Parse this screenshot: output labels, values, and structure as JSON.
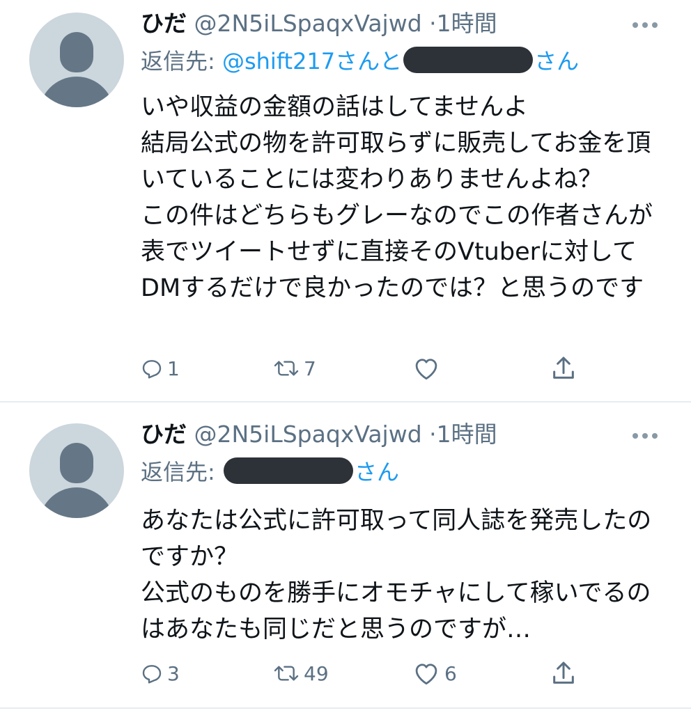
{
  "tweets": [
    {
      "author_name": "ひだ",
      "handle": "@2N5iLSpaqxVajwd",
      "separator": "·",
      "time": "1時間",
      "reply_label": "返信先:",
      "reply_mention": "@shift217さんと",
      "reply_suffix": "さん",
      "text": "いや収益の金額の話はしてませんよ\n結局公式の物を許可取らずに販売してお金を頂いていることには変わりありませんよね？\nこの件はどちらもグレーなのでこの作者さんが表でツイートせずに直接そのVtuberに対してDMするだけで良かったのでは？と思うのです",
      "reply_count": "1",
      "retweet_count": "7",
      "like_count": ""
    },
    {
      "author_name": "ひだ",
      "handle": "@2N5iLSpaqxVajwd",
      "separator": "·",
      "time": "1時間",
      "reply_label": "返信先:",
      "reply_suffix": "さん",
      "text": "あなたは公式に許可取って同人誌を発売したのですか？\n公式のものを勝手にオモチャにして稼いでるのはあなたも同じだと思うのですが…",
      "reply_count": "3",
      "retweet_count": "49",
      "like_count": "6"
    }
  ],
  "icons": [
    "more-icon",
    "reply-icon",
    "retweet-icon",
    "like-icon",
    "share-icon"
  ],
  "colors": {
    "text": "#0f1419",
    "secondary": "#5b7083",
    "link": "#1d9bf0",
    "avatar_bg": "#ccd6dd"
  }
}
